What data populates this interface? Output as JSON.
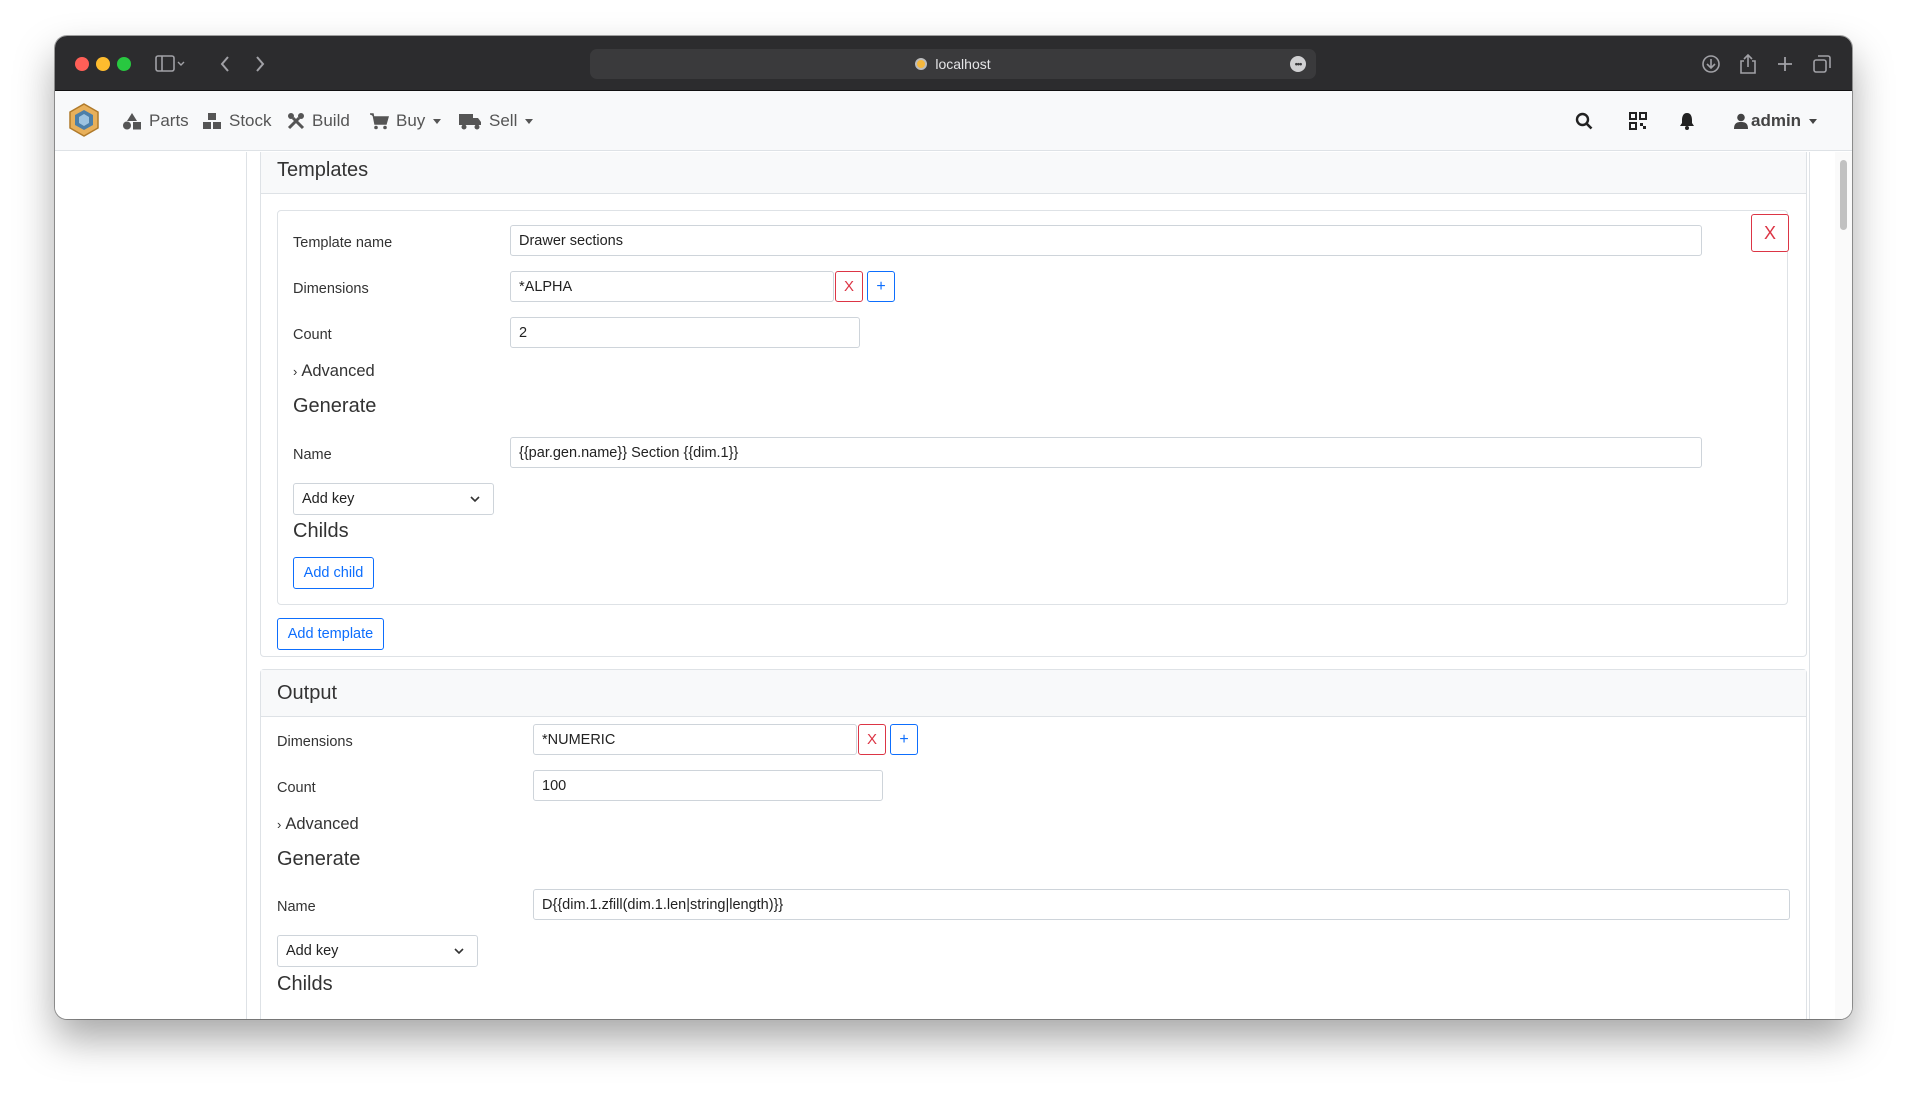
{
  "browser": {
    "url": "localhost"
  },
  "nav": {
    "items": [
      {
        "label": "Parts",
        "icon": "shapes-icon"
      },
      {
        "label": "Stock",
        "icon": "boxes-icon"
      },
      {
        "label": "Build",
        "icon": "tools-icon"
      },
      {
        "label": "Buy",
        "icon": "cart-icon",
        "dropdown": true
      },
      {
        "label": "Sell",
        "icon": "truck-icon",
        "dropdown": true
      }
    ],
    "user": "admin"
  },
  "templates": {
    "title": "Templates",
    "template": {
      "name_label": "Template name",
      "name_value": "Drawer sections",
      "dimensions_label": "Dimensions",
      "dimensions_value": "*ALPHA",
      "count_label": "Count",
      "count_value": "2",
      "advanced_label": "Advanced",
      "generate_title": "Generate",
      "gen_name_label": "Name",
      "gen_name_value": "{{par.gen.name}} Section {{dim.1}}",
      "add_key_label": "Add key",
      "childs_title": "Childs",
      "add_child_label": "Add child",
      "remove_label": "X",
      "dim_remove_label": "X",
      "dim_add_label": "+"
    },
    "add_template_label": "Add template"
  },
  "output": {
    "title": "Output",
    "dimensions_label": "Dimensions",
    "dimensions_value": "*NUMERIC",
    "count_label": "Count",
    "count_value": "100",
    "advanced_label": "Advanced",
    "generate_title": "Generate",
    "gen_name_label": "Name",
    "gen_name_value": "D{{dim.1.zfill(dim.1.len|string|length)}}",
    "add_key_label": "Add key",
    "childs_title": "Childs",
    "dim_remove_label": "X",
    "dim_add_label": "+"
  },
  "colors": {
    "danger": "#dc3545",
    "primary": "#0d6efd",
    "navbar_bg": "#f8f9fa",
    "titlebar_bg": "#2c2c2e"
  }
}
